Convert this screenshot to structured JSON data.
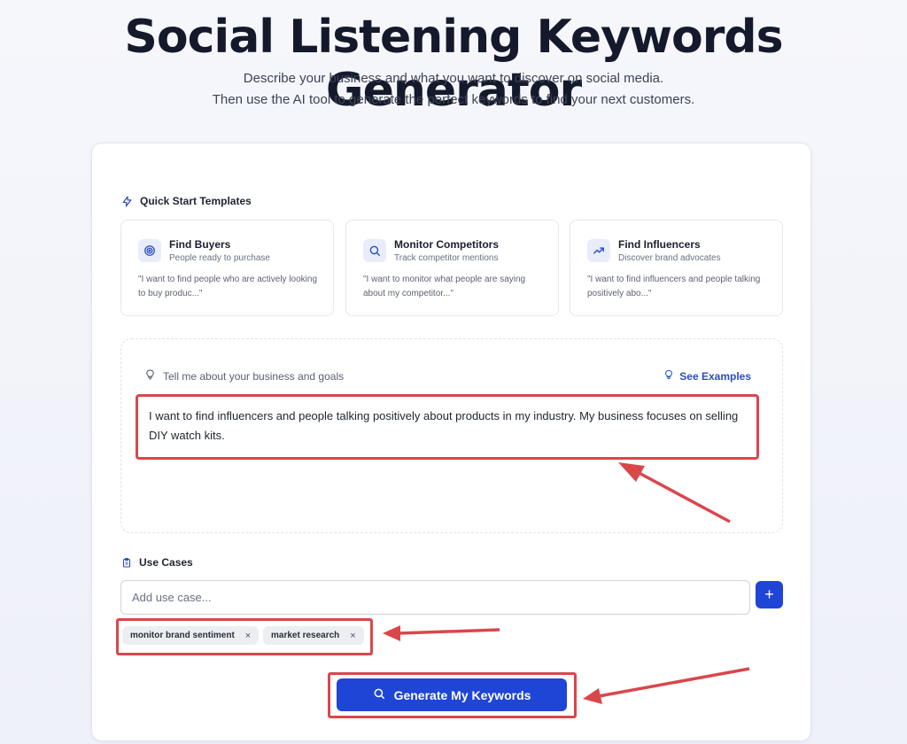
{
  "header": {
    "title": "Social Listening Keywords Generator",
    "subtitle_line1": "Describe your business and what you want to discover on social media.",
    "subtitle_line2": "Then use the AI tool to generate the perfect keywords to find your next customers."
  },
  "quick_start": {
    "heading": "Quick Start Templates",
    "heading_icon": "lightning-icon",
    "templates": [
      {
        "title": "Find Buyers",
        "subtitle": "People ready to purchase",
        "quote": "\"I want to find people who are actively looking to buy produc...\"",
        "icon": "target-icon"
      },
      {
        "title": "Monitor Competitors",
        "subtitle": "Track competitor mentions",
        "quote": "\"I want to monitor what people are saying about my competitor...\"",
        "icon": "search-icon"
      },
      {
        "title": "Find Influencers",
        "subtitle": "Discover brand advocates",
        "quote": "\"I want to find influencers and people talking positively abo...\"",
        "icon": "trending-up-icon"
      }
    ]
  },
  "goals": {
    "label": "Tell me about your business and goals",
    "see_examples": "See Examples",
    "text": "I want to find influencers and people talking positively about products in my industry. My business focuses on selling DIY watch kits."
  },
  "use_cases": {
    "heading": "Use Cases",
    "input_placeholder": "Add use case...",
    "add_label": "+",
    "tags": [
      "monitor brand sentiment",
      "market research"
    ],
    "tag_remove": "×"
  },
  "generate": {
    "label": "Generate My Keywords"
  },
  "colors": {
    "accent": "#1f45d6",
    "annotation": "#d9474b",
    "icon_bg": "#e9edfb"
  }
}
